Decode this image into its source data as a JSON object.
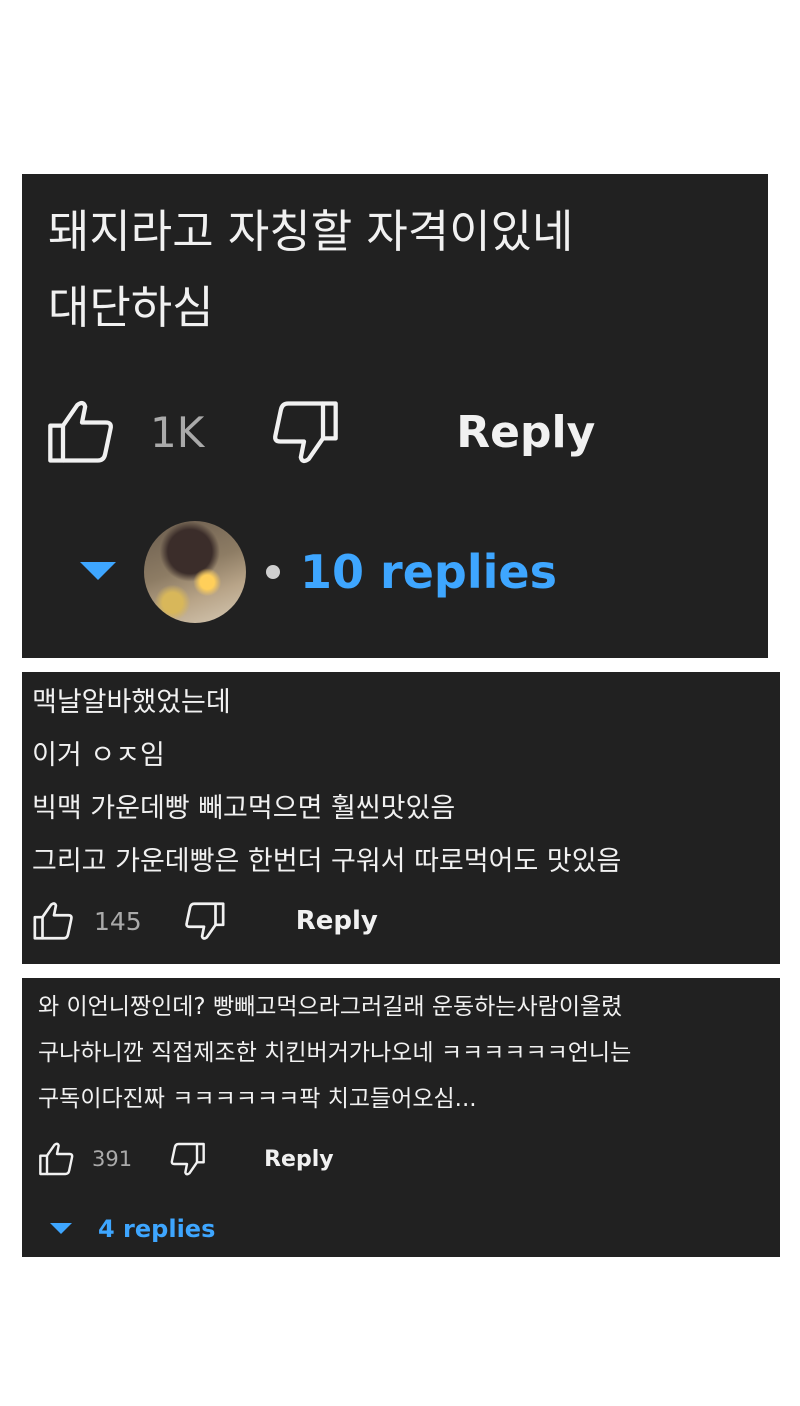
{
  "comments": [
    {
      "lines": [
        "돼지라고 자칭할 자격이있네",
        "대단하심"
      ],
      "likes": "1K",
      "reply_label": "Reply",
      "replies_label": "10 replies",
      "has_avatar": true
    },
    {
      "lines": [
        "맥날알바했었는데",
        "이거 ㅇㅈ임",
        "빅맥 가운데빵 빼고먹으면 훨씬맛있음",
        "그리고 가운데빵은 한번더 구워서 따로먹어도 맛있음"
      ],
      "likes": "145",
      "reply_label": "Reply"
    },
    {
      "lines": [
        "와 이언니짱인데? 빵빼고먹으라그러길래 운동하는사람이올렸",
        "구나하니깐 직접제조한 치킨버거가나오네 ㅋㅋㅋㅋㅋㅋ언니는",
        "구독이다진짜 ㅋㅋㅋㅋㅋㅋ팍 치고들어오심..."
      ],
      "likes": "391",
      "reply_label": "Reply",
      "replies_label": "4 replies"
    }
  ],
  "colors": {
    "card_background": "#212121",
    "text": "#f1f1f1",
    "muted": "#aaaaaa",
    "accent": "#3ea6ff"
  },
  "icons": {
    "like": "thumbs-up-outline",
    "dislike": "thumbs-down-outline",
    "expand": "triangle-down"
  }
}
